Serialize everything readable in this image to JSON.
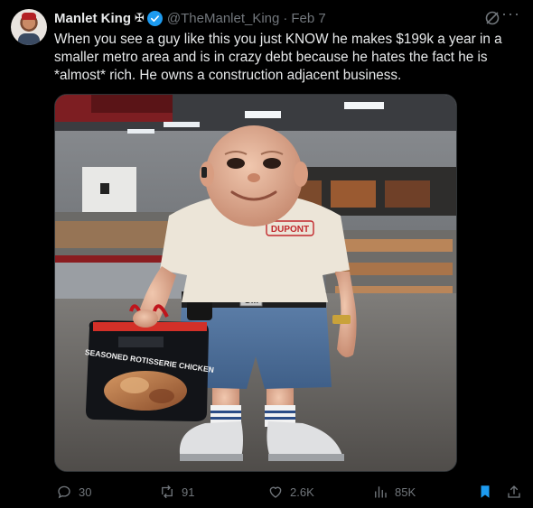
{
  "tweet": {
    "author_name": "Manlet King",
    "author_suffix": "✠",
    "handle": "@TheManlet_King",
    "separator": "·",
    "date": "Feb 7",
    "more": "···",
    "text": "When you see a guy like this you just KNOW he makes $199k a year in a smaller metro area and is in crazy debt because he hates the fact he is *almost* rich. He owns a construction adjacent business.",
    "image": {
      "shirt_text": "DUPONT",
      "belt_text": "GM",
      "bag_text": "SEASONED ROTISSERIE CHICKEN"
    }
  },
  "actions": {
    "replies": "30",
    "reposts": "91",
    "likes": "2.6K",
    "views": "85K"
  },
  "colors": {
    "background": "#000000",
    "text": "#e7e9ea",
    "muted": "#71767b",
    "verified": "#1d9bf0"
  }
}
